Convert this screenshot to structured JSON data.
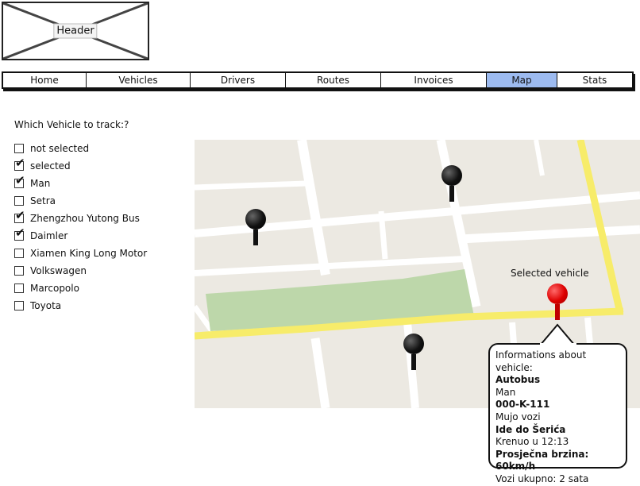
{
  "header": {
    "label": "Header"
  },
  "nav": {
    "tabs": [
      {
        "label": "Home"
      },
      {
        "label": "Vehicles"
      },
      {
        "label": "Drivers"
      },
      {
        "label": "Routes"
      },
      {
        "label": "Invoices"
      },
      {
        "label": "Map",
        "active": true
      },
      {
        "label": "Stats"
      }
    ]
  },
  "filter": {
    "title": "Which Vehicle to track:?",
    "items": [
      {
        "label": "not selected",
        "checked": false
      },
      {
        "label": "selected",
        "checked": true
      },
      {
        "label": "Man",
        "checked": true
      },
      {
        "label": "Setra",
        "checked": false
      },
      {
        "label": "Zhengzhou Yutong Bus",
        "checked": true
      },
      {
        "label": "Daimler",
        "checked": true
      },
      {
        "label": "Xiamen King Long Motor",
        "checked": false
      },
      {
        "label": "Volkswagen",
        "checked": false
      },
      {
        "label": "Marcopolo",
        "checked": false
      },
      {
        "label": "Toyota",
        "checked": false
      }
    ]
  },
  "map": {
    "selected_label": "Selected vehicle",
    "colors": {
      "land": "#ece9e2",
      "road": "#ffffff",
      "main_road": "#f7ec6a",
      "park": "#bdd7aa",
      "selected_pin": "#dd0000"
    }
  },
  "info": {
    "title": "Informations about vehicle:",
    "type": "Autobus",
    "brand": "Man",
    "plate": "000-K-111",
    "driver": "Mujo vozi",
    "destination": "Ide do Šerića",
    "departure": "Krenuo u 12:13",
    "avg_speed": "Prosječna brzina: 60km/h",
    "total_time": "Vozi ukupno: 2 sata"
  }
}
